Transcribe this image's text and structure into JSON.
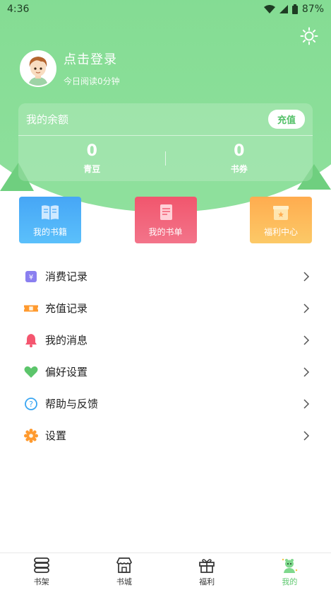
{
  "status_bar": {
    "time": "4:36",
    "battery": "87%"
  },
  "profile": {
    "login_label": "点击登录",
    "read_time": "今日阅读0分钟"
  },
  "balance": {
    "title": "我的余额",
    "recharge_label": "充值",
    "items": [
      {
        "value": "0",
        "label": "青豆"
      },
      {
        "value": "0",
        "label": "书券"
      }
    ]
  },
  "tiles": [
    {
      "label": "我的书籍",
      "icon": "book-icon"
    },
    {
      "label": "我的书单",
      "icon": "booklist-icon"
    },
    {
      "label": "福利中心",
      "icon": "gift-box-icon"
    }
  ],
  "menu": [
    {
      "label": "消费记录",
      "icon": "yuan-record-icon",
      "color": "#8a7ff0"
    },
    {
      "label": "充值记录",
      "icon": "ticket-icon",
      "color": "#ff9a2e"
    },
    {
      "label": "我的消息",
      "icon": "bell-icon",
      "color": "#f4566f"
    },
    {
      "label": "偏好设置",
      "icon": "heart-icon",
      "color": "#5cc56b"
    },
    {
      "label": "帮助与反馈",
      "icon": "help-icon",
      "color": "#3aa6f2"
    },
    {
      "label": "设置",
      "icon": "gear-icon",
      "color": "#ff9a2e"
    }
  ],
  "bottom_nav": [
    {
      "label": "书架",
      "icon": "bookshelf-icon",
      "active": false
    },
    {
      "label": "书城",
      "icon": "bookstore-icon",
      "active": false
    },
    {
      "label": "福利",
      "icon": "gift-icon",
      "active": false
    },
    {
      "label": "我的",
      "icon": "profile-mascot-icon",
      "active": true
    }
  ],
  "colors": {
    "brand_green": "#7fd88d",
    "active_tab": "#5ec86f"
  }
}
